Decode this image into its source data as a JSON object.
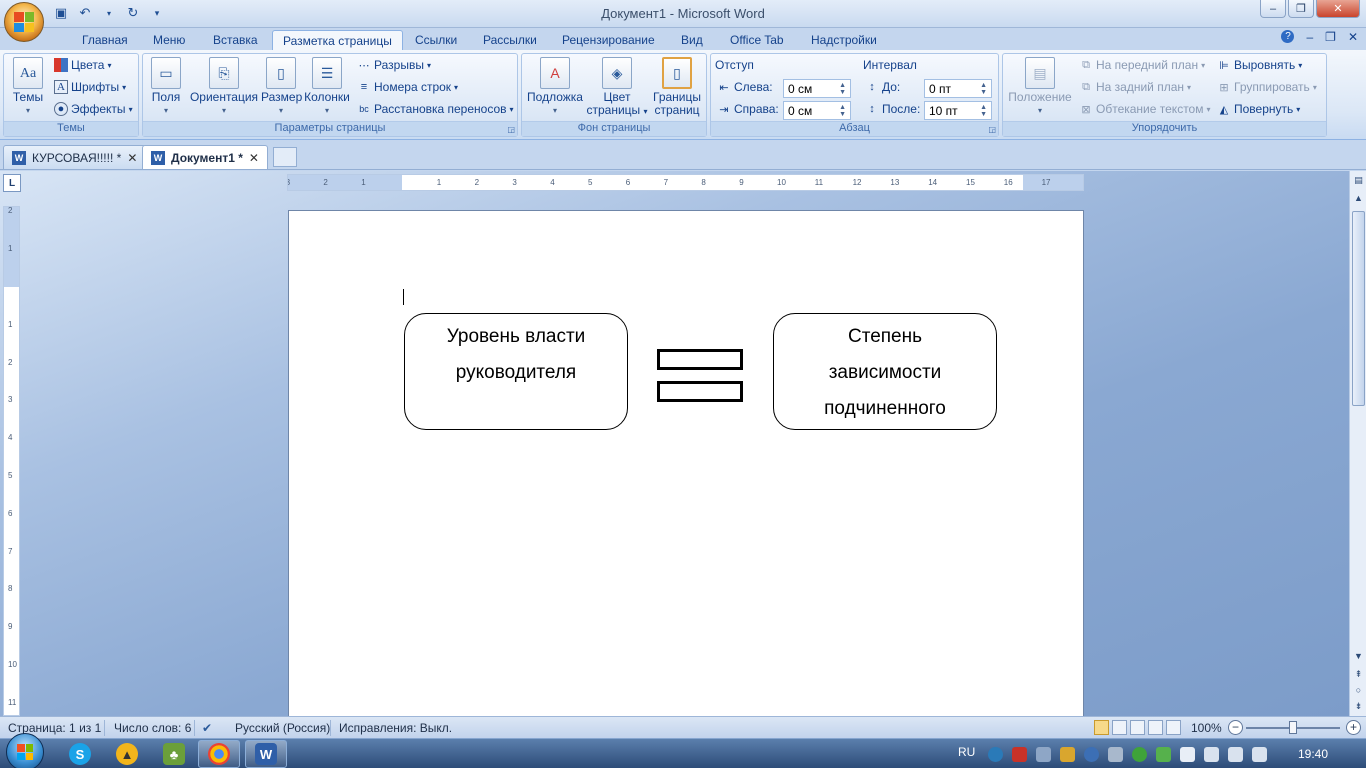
{
  "window": {
    "title": "Документ1 - Microsoft Word",
    "minimize": "‒",
    "maximize": "❐",
    "close": "✕"
  },
  "ribbon_tabs": [
    {
      "label": "Главная"
    },
    {
      "label": "Меню"
    },
    {
      "label": "Вставка"
    },
    {
      "label": "Разметка страницы",
      "active": true
    },
    {
      "label": "Ссылки"
    },
    {
      "label": "Рассылки"
    },
    {
      "label": "Рецензирование"
    },
    {
      "label": "Вид"
    },
    {
      "label": "Office Tab"
    },
    {
      "label": "Надстройки"
    }
  ],
  "ribbon": {
    "themes": {
      "group": "Темы",
      "themes_btn": "Темы",
      "colors": "Цвета",
      "fonts": "Шрифты",
      "effects": "Эффекты"
    },
    "page_setup": {
      "group": "Параметры страницы",
      "margins": "Поля",
      "orientation": "Ориентация",
      "size": "Размер",
      "columns": "Колонки",
      "breaks": "Разрывы",
      "line_numbers": "Номера строк",
      "hyphenation": "Расстановка переносов"
    },
    "page_background": {
      "group": "Фон страницы",
      "watermark": "Подложка",
      "page_color_1": "Цвет",
      "page_color_2": "страницы",
      "borders_1": "Границы",
      "borders_2": "страниц"
    },
    "paragraph": {
      "group": "Абзац",
      "indent_title": "Отступ",
      "left_label": "Слева:",
      "left_value": "0 см",
      "right_label": "Справа:",
      "right_value": "0 см",
      "spacing_title": "Интервал",
      "before_label": "До:",
      "before_value": "0 пт",
      "after_label": "После:",
      "after_value": "10 пт"
    },
    "arrange": {
      "group": "Упорядочить",
      "position": "Положение",
      "bring_front": "На передний план",
      "send_back": "На задний план",
      "text_wrap": "Обтекание текстом",
      "align": "Выровнять",
      "group_btn": "Группировать",
      "rotate": "Повернуть"
    }
  },
  "doc_tabs": [
    {
      "label": "КУРСОВАЯ!!!!! *"
    },
    {
      "label": "Документ1 *",
      "active": true
    }
  ],
  "document": {
    "left_box": [
      "Уровень власти",
      "руководителя"
    ],
    "right_box": [
      "Степень",
      "зависимости",
      "подчиненного"
    ]
  },
  "rulers": {
    "horizontal_ticks": [
      "3",
      "2",
      "1",
      "1",
      "2",
      "3",
      "4",
      "5",
      "6",
      "7",
      "8",
      "9",
      "10",
      "11",
      "12",
      "13",
      "14",
      "15",
      "16",
      "17"
    ],
    "vertical_ticks": [
      "2",
      "1",
      "1",
      "2",
      "3",
      "4",
      "5",
      "6",
      "7",
      "8",
      "9",
      "10",
      "11"
    ]
  },
  "statusbar": {
    "page": "Страница: 1 из 1",
    "words": "Число слов: 6",
    "language": "Русский (Россия)",
    "track_changes": "Исправления: Выкл.",
    "zoom": "100%"
  },
  "taskbar": {
    "lang": "RU",
    "time": "19:40"
  },
  "colors": {
    "ribbon_text": "#15428b",
    "accent_blue": "#c4d6ee",
    "taskbar": "#2d4c78"
  }
}
